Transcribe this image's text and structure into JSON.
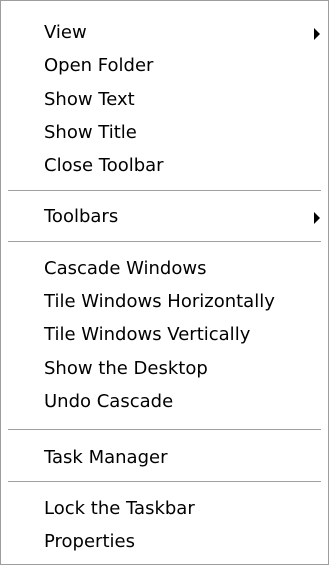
{
  "menu": {
    "items": [
      {
        "label": "View",
        "submenu": true
      },
      {
        "label": "Open Folder",
        "submenu": false
      },
      {
        "label": "Show Text",
        "submenu": false
      },
      {
        "label": "Show Title",
        "submenu": false
      },
      {
        "label": "Close Toolbar",
        "submenu": false
      },
      {
        "label": "Toolbars",
        "submenu": true
      },
      {
        "label": "Cascade Windows",
        "submenu": false
      },
      {
        "label": "Tile Windows Horizontally",
        "submenu": false
      },
      {
        "label": "Tile Windows Vertically",
        "submenu": false
      },
      {
        "label": "Show the Desktop",
        "submenu": false
      },
      {
        "label": "Undo Cascade",
        "submenu": false
      },
      {
        "label": "Task Manager",
        "submenu": false
      },
      {
        "label": "Lock the Taskbar",
        "submenu": false
      },
      {
        "label": "Properties",
        "submenu": false
      }
    ],
    "submenu_icon": "triangle-right-icon"
  }
}
